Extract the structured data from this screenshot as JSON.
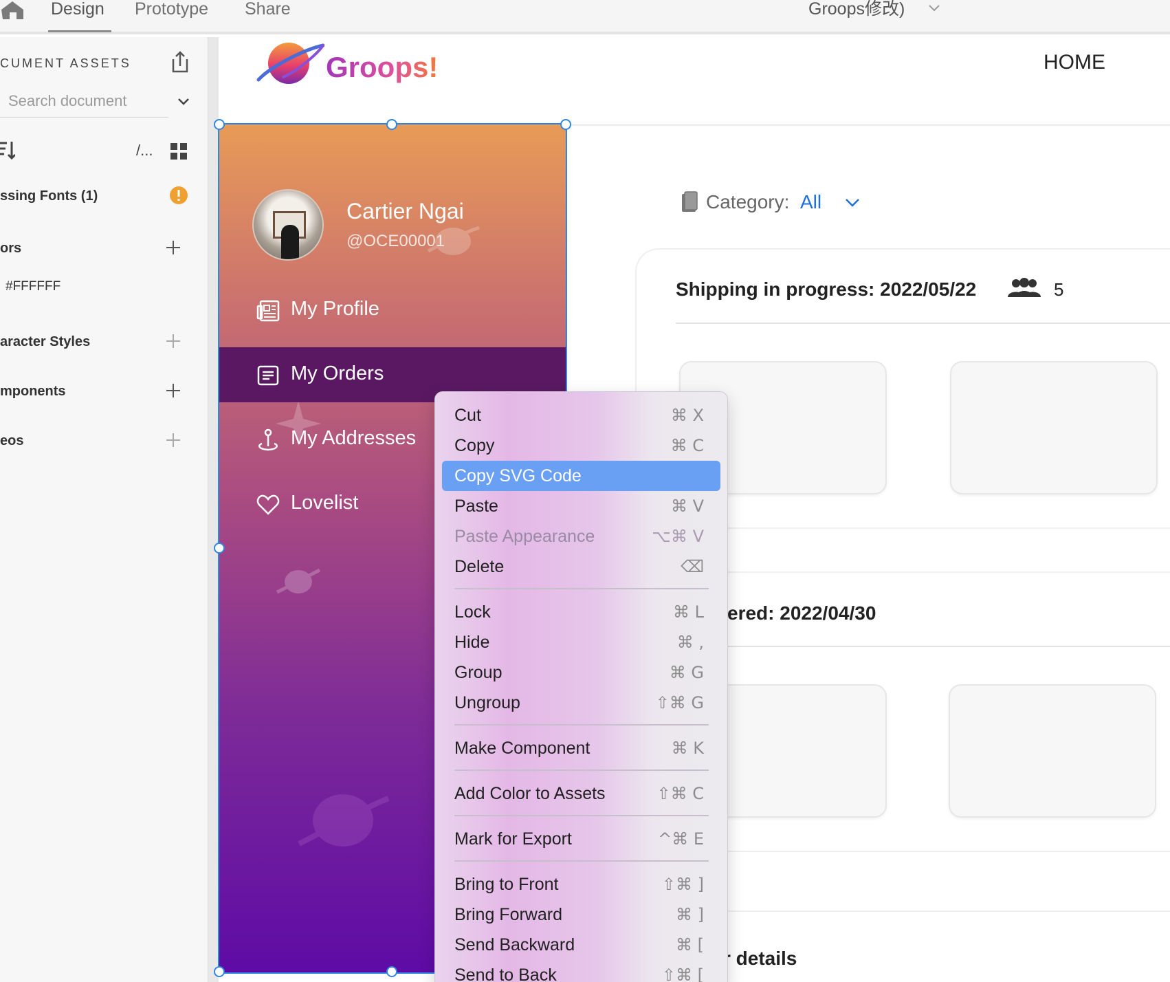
{
  "toolbar": {
    "tabs": [
      "Design",
      "Prototype",
      "Share"
    ],
    "active_tab": "Design",
    "document_title": "Groops修改)"
  },
  "assets": {
    "title": "CUMENT ASSETS",
    "search_placeholder": "Search document",
    "path_label": "/...",
    "missing_fonts": "ssing Fonts (1)",
    "colors_label": "ors",
    "color_value": "#FFFFFF",
    "character_styles_label": "aracter Styles",
    "components_label": "mponents",
    "videos_label": "eos"
  },
  "site": {
    "logo_text": "Groops!",
    "nav_home": "HOME"
  },
  "sidebar": {
    "user_name": "Cartier Ngai",
    "user_handle": "@OCE00001",
    "items": [
      {
        "label": "My Profile",
        "icon": "profile-card-icon"
      },
      {
        "label": "My Orders",
        "icon": "orders-list-icon",
        "active": true
      },
      {
        "label": "My Addresses",
        "icon": "location-pin-icon"
      },
      {
        "label": "Lovelist",
        "icon": "heart-icon"
      }
    ]
  },
  "content": {
    "category_label": "Category:",
    "category_value": "All",
    "orders": [
      {
        "title": "Shipping in progress: 2022/05/22",
        "people_count": "5"
      },
      {
        "title": "ered: 2022/04/30"
      },
      {
        "title": "r details"
      }
    ]
  },
  "context_menu": {
    "items": [
      {
        "label": "Cut",
        "shortcut": "⌘ X"
      },
      {
        "label": "Copy",
        "shortcut": "⌘ C"
      },
      {
        "label": "Copy SVG Code",
        "shortcut": "",
        "highlighted": true
      },
      {
        "label": "Paste",
        "shortcut": "⌘ V"
      },
      {
        "label": "Paste Appearance",
        "shortcut": "⌥⌘ V",
        "disabled": true
      },
      {
        "label": "Delete",
        "shortcut": "⌫"
      },
      {
        "label": "Lock",
        "shortcut": "⌘ L"
      },
      {
        "label": "Hide",
        "shortcut": "⌘ ,"
      },
      {
        "label": "Group",
        "shortcut": "⌘ G"
      },
      {
        "label": "Ungroup",
        "shortcut": "⇧⌘ G"
      },
      {
        "label": "Make Component",
        "shortcut": "⌘ K"
      },
      {
        "label": "Add Color to Assets",
        "shortcut": "⇧⌘ C"
      },
      {
        "label": "Mark for Export",
        "shortcut": "^⌘ E"
      },
      {
        "label": "Bring to Front",
        "shortcut": "⇧⌘ ]"
      },
      {
        "label": "Bring Forward",
        "shortcut": "⌘ ]"
      },
      {
        "label": "Send Backward",
        "shortcut": "⌘ ["
      },
      {
        "label": "Send to Back",
        "shortcut": "⇧⌘ ["
      }
    ]
  },
  "colors": {
    "accent_blue": "#2f86e5",
    "highlight": "#6aa0f4",
    "warning": "#f0a030",
    "orders_active_bg": "#5a1863"
  }
}
